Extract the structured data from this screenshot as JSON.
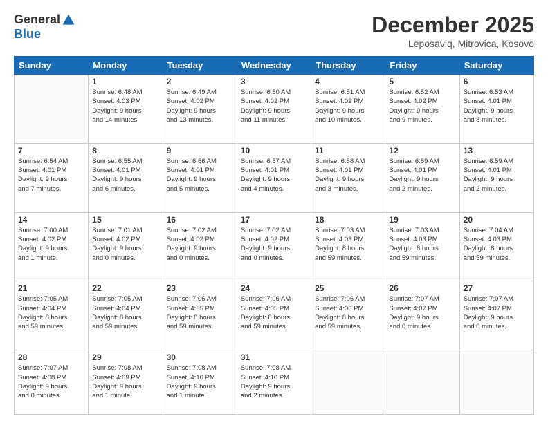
{
  "logo": {
    "general": "General",
    "blue": "Blue"
  },
  "header": {
    "month": "December 2025",
    "location": "Leposaviq, Mitrovica, Kosovo"
  },
  "weekdays": [
    "Sunday",
    "Monday",
    "Tuesday",
    "Wednesday",
    "Thursday",
    "Friday",
    "Saturday"
  ],
  "weeks": [
    [
      {
        "day": "",
        "info": ""
      },
      {
        "day": "1",
        "info": "Sunrise: 6:48 AM\nSunset: 4:03 PM\nDaylight: 9 hours\nand 14 minutes."
      },
      {
        "day": "2",
        "info": "Sunrise: 6:49 AM\nSunset: 4:02 PM\nDaylight: 9 hours\nand 13 minutes."
      },
      {
        "day": "3",
        "info": "Sunrise: 6:50 AM\nSunset: 4:02 PM\nDaylight: 9 hours\nand 11 minutes."
      },
      {
        "day": "4",
        "info": "Sunrise: 6:51 AM\nSunset: 4:02 PM\nDaylight: 9 hours\nand 10 minutes."
      },
      {
        "day": "5",
        "info": "Sunrise: 6:52 AM\nSunset: 4:02 PM\nDaylight: 9 hours\nand 9 minutes."
      },
      {
        "day": "6",
        "info": "Sunrise: 6:53 AM\nSunset: 4:01 PM\nDaylight: 9 hours\nand 8 minutes."
      }
    ],
    [
      {
        "day": "7",
        "info": "Sunrise: 6:54 AM\nSunset: 4:01 PM\nDaylight: 9 hours\nand 7 minutes."
      },
      {
        "day": "8",
        "info": "Sunrise: 6:55 AM\nSunset: 4:01 PM\nDaylight: 9 hours\nand 6 minutes."
      },
      {
        "day": "9",
        "info": "Sunrise: 6:56 AM\nSunset: 4:01 PM\nDaylight: 9 hours\nand 5 minutes."
      },
      {
        "day": "10",
        "info": "Sunrise: 6:57 AM\nSunset: 4:01 PM\nDaylight: 9 hours\nand 4 minutes."
      },
      {
        "day": "11",
        "info": "Sunrise: 6:58 AM\nSunset: 4:01 PM\nDaylight: 9 hours\nand 3 minutes."
      },
      {
        "day": "12",
        "info": "Sunrise: 6:59 AM\nSunset: 4:01 PM\nDaylight: 9 hours\nand 2 minutes."
      },
      {
        "day": "13",
        "info": "Sunrise: 6:59 AM\nSunset: 4:01 PM\nDaylight: 9 hours\nand 2 minutes."
      }
    ],
    [
      {
        "day": "14",
        "info": "Sunrise: 7:00 AM\nSunset: 4:02 PM\nDaylight: 9 hours\nand 1 minute."
      },
      {
        "day": "15",
        "info": "Sunrise: 7:01 AM\nSunset: 4:02 PM\nDaylight: 9 hours\nand 0 minutes."
      },
      {
        "day": "16",
        "info": "Sunrise: 7:02 AM\nSunset: 4:02 PM\nDaylight: 9 hours\nand 0 minutes."
      },
      {
        "day": "17",
        "info": "Sunrise: 7:02 AM\nSunset: 4:02 PM\nDaylight: 9 hours\nand 0 minutes."
      },
      {
        "day": "18",
        "info": "Sunrise: 7:03 AM\nSunset: 4:03 PM\nDaylight: 8 hours\nand 59 minutes."
      },
      {
        "day": "19",
        "info": "Sunrise: 7:03 AM\nSunset: 4:03 PM\nDaylight: 8 hours\nand 59 minutes."
      },
      {
        "day": "20",
        "info": "Sunrise: 7:04 AM\nSunset: 4:03 PM\nDaylight: 8 hours\nand 59 minutes."
      }
    ],
    [
      {
        "day": "21",
        "info": "Sunrise: 7:05 AM\nSunset: 4:04 PM\nDaylight: 8 hours\nand 59 minutes."
      },
      {
        "day": "22",
        "info": "Sunrise: 7:05 AM\nSunset: 4:04 PM\nDaylight: 8 hours\nand 59 minutes."
      },
      {
        "day": "23",
        "info": "Sunrise: 7:06 AM\nSunset: 4:05 PM\nDaylight: 8 hours\nand 59 minutes."
      },
      {
        "day": "24",
        "info": "Sunrise: 7:06 AM\nSunset: 4:05 PM\nDaylight: 8 hours\nand 59 minutes."
      },
      {
        "day": "25",
        "info": "Sunrise: 7:06 AM\nSunset: 4:06 PM\nDaylight: 8 hours\nand 59 minutes."
      },
      {
        "day": "26",
        "info": "Sunrise: 7:07 AM\nSunset: 4:07 PM\nDaylight: 9 hours\nand 0 minutes."
      },
      {
        "day": "27",
        "info": "Sunrise: 7:07 AM\nSunset: 4:07 PM\nDaylight: 9 hours\nand 0 minutes."
      }
    ],
    [
      {
        "day": "28",
        "info": "Sunrise: 7:07 AM\nSunset: 4:08 PM\nDaylight: 9 hours\nand 0 minutes."
      },
      {
        "day": "29",
        "info": "Sunrise: 7:08 AM\nSunset: 4:09 PM\nDaylight: 9 hours\nand 1 minute."
      },
      {
        "day": "30",
        "info": "Sunrise: 7:08 AM\nSunset: 4:10 PM\nDaylight: 9 hours\nand 1 minute."
      },
      {
        "day": "31",
        "info": "Sunrise: 7:08 AM\nSunset: 4:10 PM\nDaylight: 9 hours\nand 2 minutes."
      },
      {
        "day": "",
        "info": ""
      },
      {
        "day": "",
        "info": ""
      },
      {
        "day": "",
        "info": ""
      }
    ]
  ]
}
